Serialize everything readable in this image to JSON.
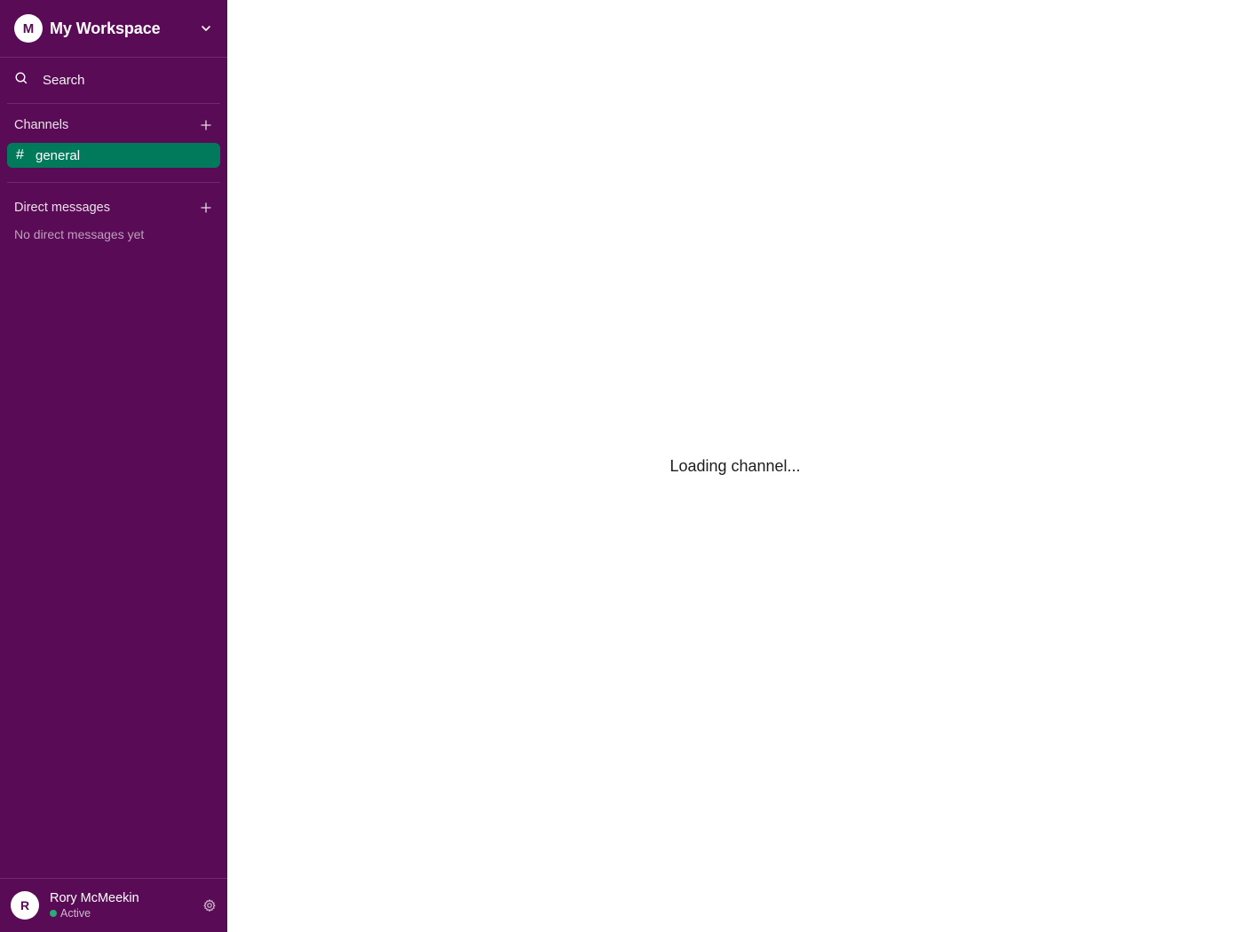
{
  "workspace": {
    "avatar_letter": "M",
    "name": "My Workspace"
  },
  "search": {
    "label": "Search"
  },
  "channels": {
    "title": "Channels",
    "items": [
      {
        "prefix": "#",
        "name": "general",
        "active": true
      }
    ]
  },
  "direct_messages": {
    "title": "Direct messages",
    "empty_text": "No direct messages yet"
  },
  "user": {
    "avatar_letter": "R",
    "name": "Rory McMeekin",
    "status": "Active"
  },
  "main": {
    "loading_text": "Loading channel..."
  },
  "colors": {
    "sidebar_bg": "#5a0b56",
    "active_channel_bg": "#007a5a",
    "status_active": "#2bac76"
  },
  "icons": {
    "workspace_menu": "chevron-down-icon",
    "search": "search-icon",
    "add_channel": "plus-icon",
    "add_dm": "plus-icon",
    "settings": "gear-icon"
  }
}
